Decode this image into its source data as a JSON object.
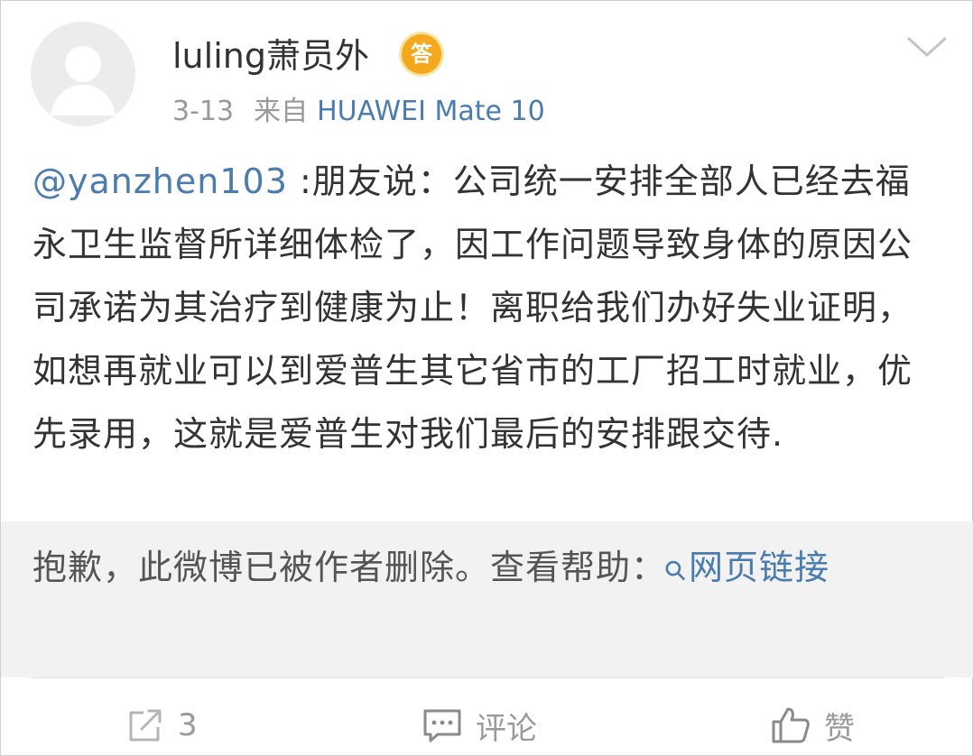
{
  "post": {
    "username": "luling萧员外",
    "badge_label": "答",
    "date": "3-13",
    "source_prefix": "来自",
    "device": "HUAWEI Mate 10",
    "mention": "@yanzhen103",
    "body": " :朋友说：公司统一安排全部人已经去福永卫生监督所详细体检了，因工作问题导致身体的原因公司承诺为其治疗到健康为止！离职给我们办好失业证明，如想再就业可以到爱普生其它省市的工厂招工时就业，优先录用，这就是爱普生对我们最后的安排跟交待."
  },
  "deleted_notice": {
    "text": "抱歉，此微博已被作者删除。查看帮助：",
    "link_icon": "link-icon",
    "link_text": "网页链接"
  },
  "actions": {
    "share_count": "3",
    "comment_label": "评论",
    "like_label": "赞"
  },
  "icons": {
    "avatar": "default-avatar-icon",
    "dropdown": "chevron-down-icon",
    "share": "share-icon",
    "comment": "comment-icon",
    "like": "thumbs-up-icon"
  },
  "colors": {
    "link": "#4b7cb0",
    "badge": "#f4a81d",
    "muted": "#999999",
    "deleted_bg": "#f2f2f2"
  }
}
